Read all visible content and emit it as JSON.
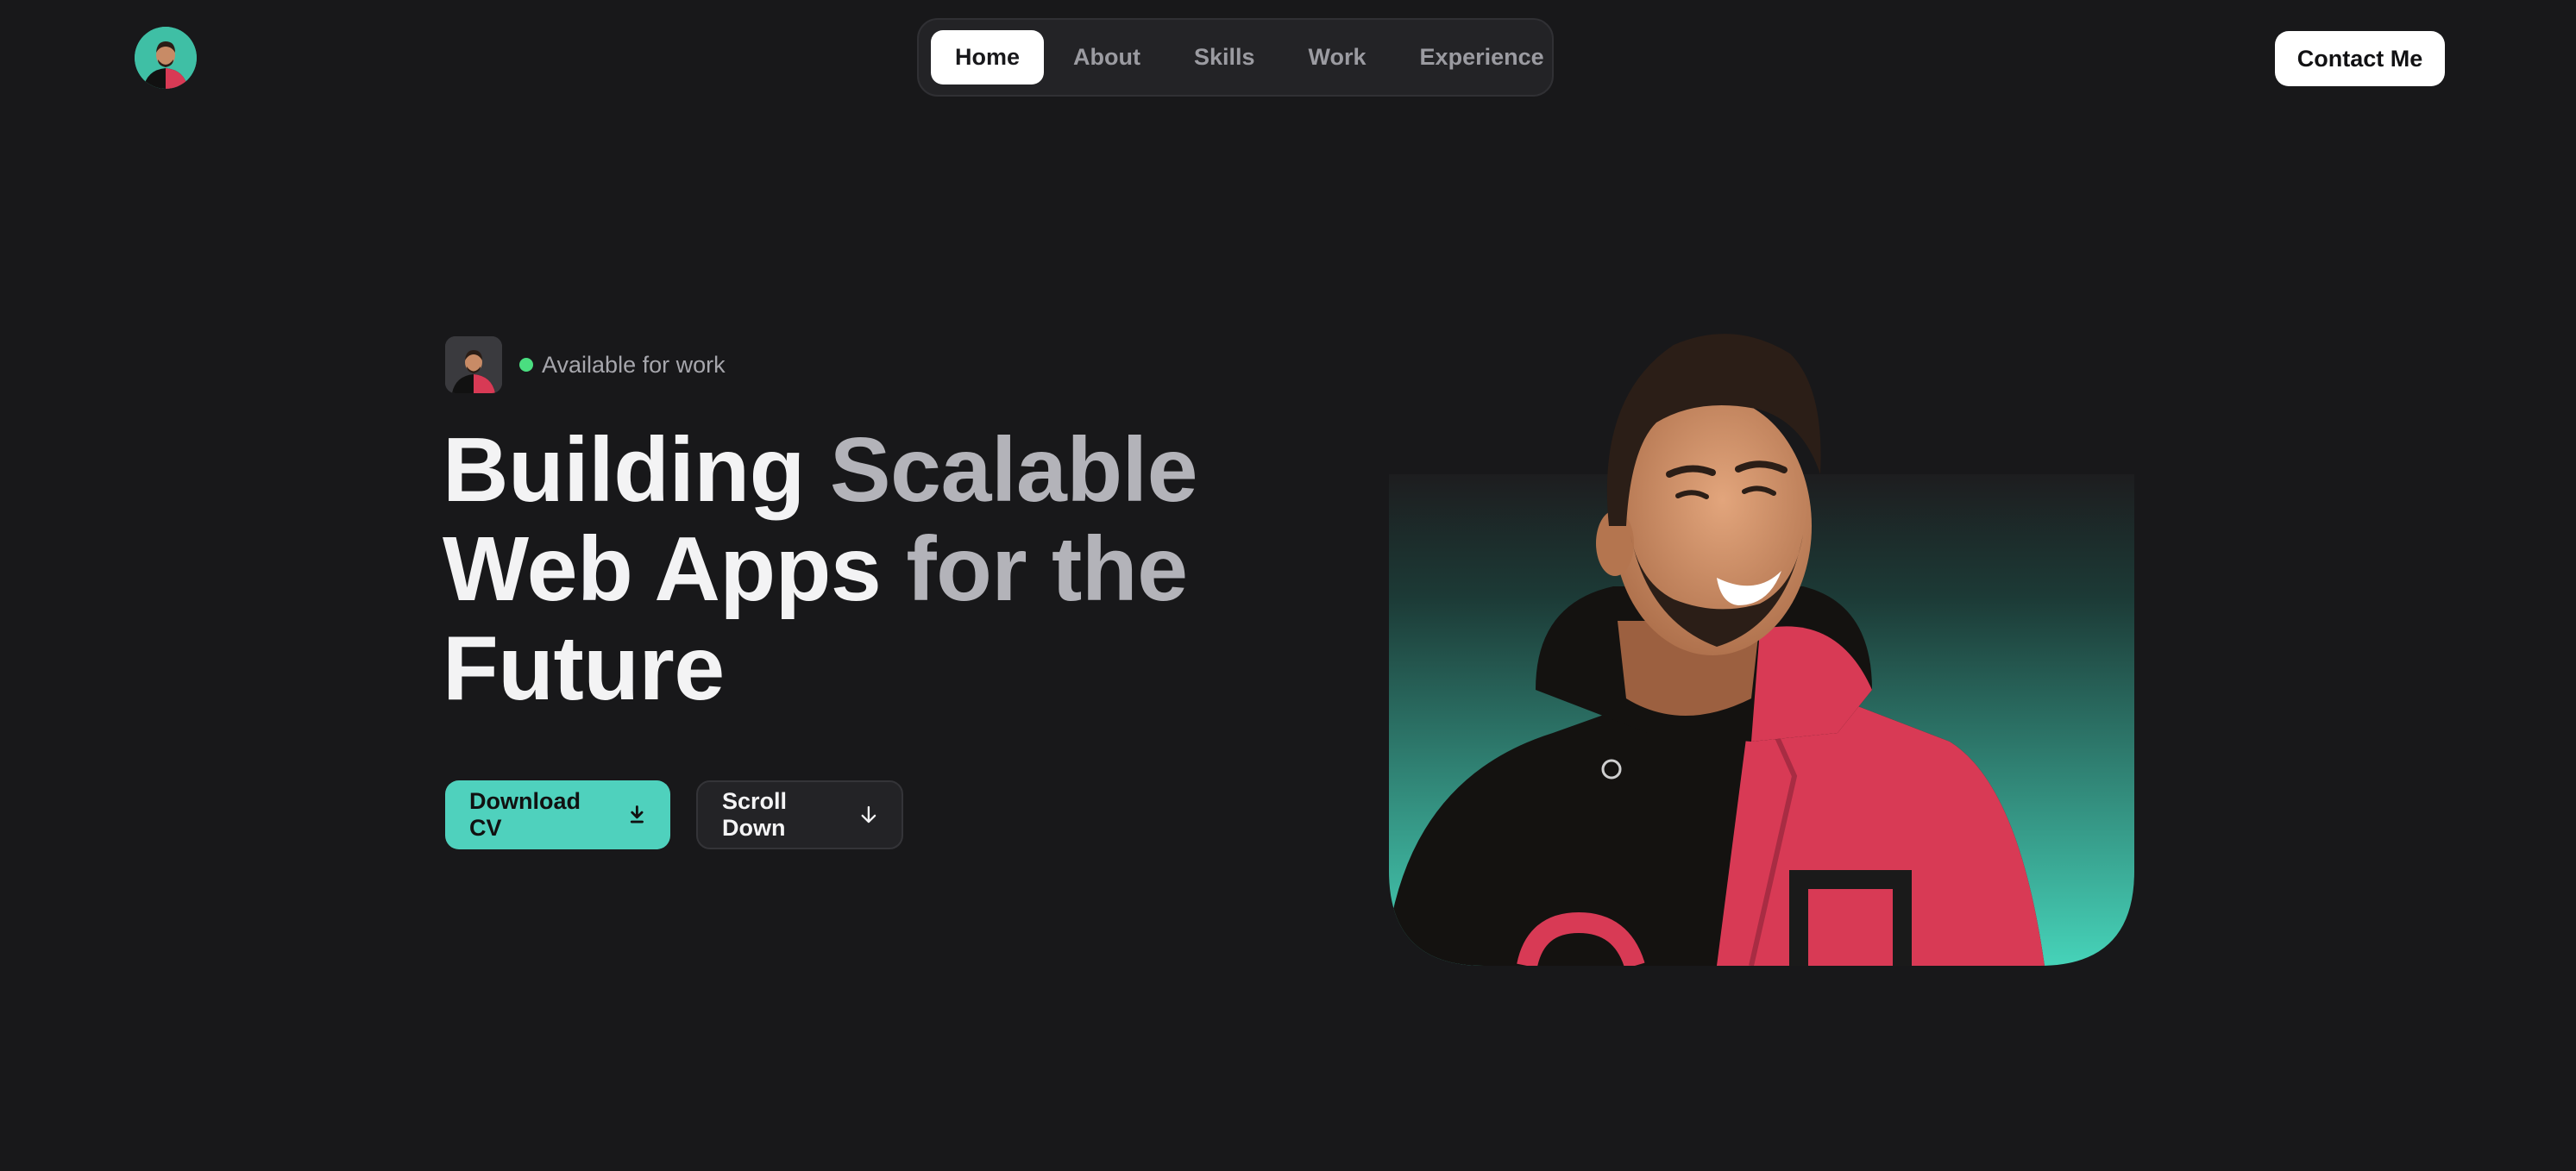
{
  "nav": {
    "items": [
      {
        "label": "Home",
        "active": true
      },
      {
        "label": "About",
        "active": false
      },
      {
        "label": "Skills",
        "active": false
      },
      {
        "label": "Work",
        "active": false
      },
      {
        "label": "Experience",
        "active": false
      }
    ],
    "contact_label": "Contact Me"
  },
  "hero": {
    "status": "Available for work",
    "headline": {
      "line1": [
        "Building ",
        "Scalable"
      ],
      "line2": [
        "Web Apps ",
        "for the"
      ],
      "line3": [
        "Future",
        ""
      ]
    },
    "primary_button": {
      "label": "Download CV",
      "icon": "download-icon"
    },
    "secondary_button": {
      "label": "Scroll Down",
      "icon": "arrow-down-icon"
    }
  },
  "colors": {
    "background": "#18181a",
    "accent": "#4fd1bd",
    "status_dot": "#4ade80",
    "hoodie_red": "#d83a55",
    "photo_bg_top": "#1d1d1f",
    "photo_bg_bottom": "#46d3b9"
  }
}
